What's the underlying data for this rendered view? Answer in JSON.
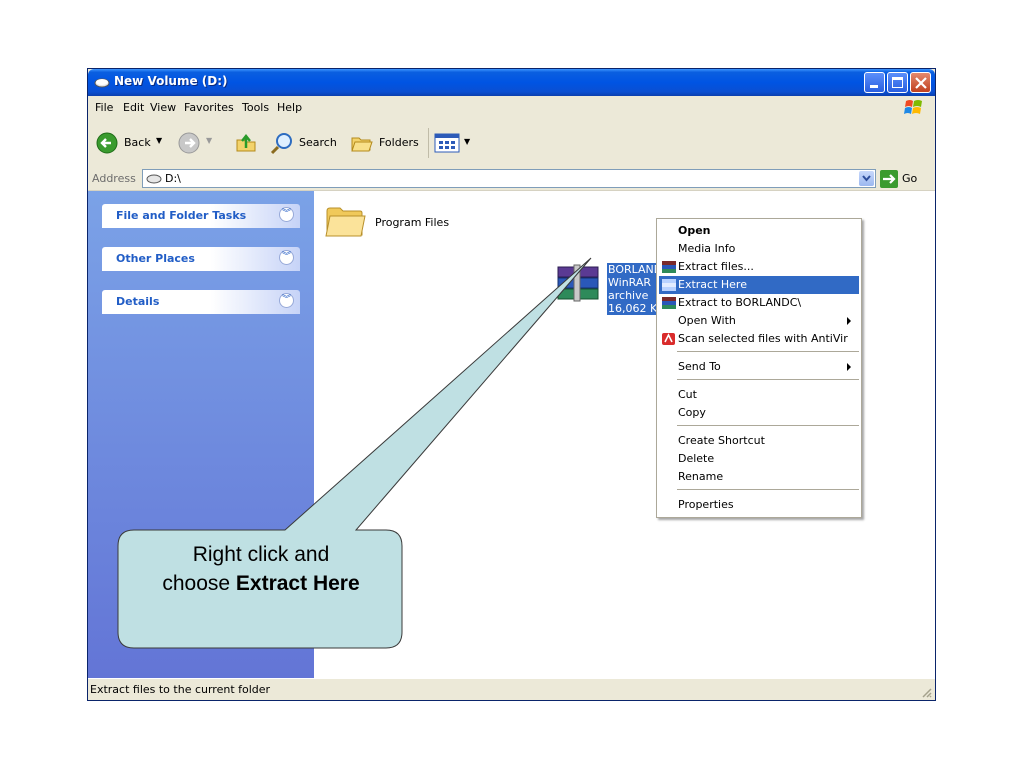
{
  "window": {
    "title": "New Volume (D:)",
    "menus": [
      "File",
      "Edit",
      "View",
      "Favorites",
      "Tools",
      "Help"
    ]
  },
  "toolbar": {
    "back_label": "Back",
    "search_label": "Search",
    "folders_label": "Folders"
  },
  "address": {
    "label": "Address",
    "value": "D:\\",
    "go_label": "Go"
  },
  "sidebar": {
    "panels": [
      {
        "title": "File and Folder Tasks"
      },
      {
        "title": "Other Places"
      },
      {
        "title": "Details"
      }
    ]
  },
  "files": [
    {
      "name": "Program Files",
      "type": "folder"
    },
    {
      "name": "BORLANDC.rar",
      "type_label": "WinRAR archive",
      "size": "16,062 KB"
    }
  ],
  "context_menu": {
    "items": [
      {
        "label": "Open",
        "bold": true
      },
      {
        "label": "Media Info"
      },
      {
        "label": "Extract files..."
      },
      {
        "label": "Extract Here",
        "highlighted": true
      },
      {
        "label": "Extract to BORLANDC\\"
      },
      {
        "label": "Open With",
        "submenu": true
      },
      {
        "label": "Scan selected files with AntiVir"
      },
      {
        "label": "Send To",
        "submenu": true
      },
      {
        "label": "Cut"
      },
      {
        "label": "Copy"
      },
      {
        "label": "Create Shortcut"
      },
      {
        "label": "Delete"
      },
      {
        "label": "Rename"
      },
      {
        "label": "Properties"
      }
    ]
  },
  "status": {
    "text": "Extract files to the current folder"
  },
  "callout": {
    "line1": "Right click and",
    "line2_prefix": "choose ",
    "line2_bold": "Extract Here"
  },
  "colors": {
    "title_bar": "#0054e3",
    "sidebar_top": "#7ba2e7",
    "sidebar_bottom": "#6375d6",
    "selection": "#316ac5",
    "callout_fill": "#bfe0e3"
  }
}
